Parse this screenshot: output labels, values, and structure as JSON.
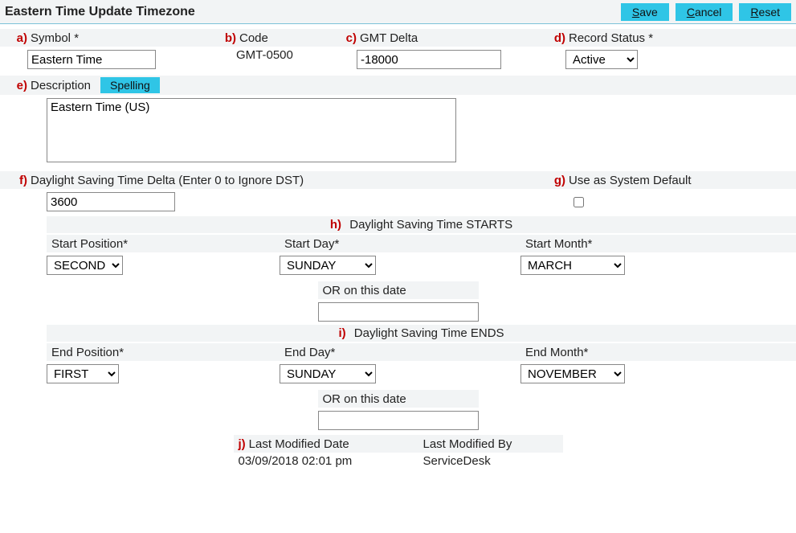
{
  "title": "Eastern Time Update Timezone",
  "buttons": {
    "save": "Save",
    "cancel": "Cancel",
    "reset": "Reset"
  },
  "markers": {
    "a": "a)",
    "b": "b)",
    "c": "c)",
    "d": "d)",
    "e": "e)",
    "f": "f)",
    "g": "g)",
    "h": "h)",
    "i": "i)",
    "j": "j)"
  },
  "fields": {
    "symbol": {
      "label": "Symbol",
      "value": "Eastern Time"
    },
    "code": {
      "label": "Code",
      "value": "GMT-0500"
    },
    "gmtdelta": {
      "label": "GMT Delta",
      "value": "-18000"
    },
    "recordstatus": {
      "label": "Record Status",
      "value": "Active"
    },
    "description": {
      "label": "Description",
      "spelling_btn": "Spelling",
      "value": "Eastern Time (US)"
    },
    "dstdelta": {
      "label": "Daylight Saving Time Delta (Enter 0 to Ignore DST)",
      "value": "3600"
    },
    "sysdefault": {
      "label": "Use as System Default",
      "checked": false
    },
    "dst_starts_header": "Daylight Saving Time STARTS",
    "start_position": {
      "label": "Start Position",
      "value": "SECOND"
    },
    "start_day": {
      "label": "Start Day",
      "value": "SUNDAY"
    },
    "start_month": {
      "label": "Start Month",
      "value": "MARCH"
    },
    "or_on_date_label": "OR on this date",
    "start_or_date": "",
    "dst_ends_header": "Daylight Saving Time ENDS",
    "end_position": {
      "label": "End Position",
      "value": "FIRST"
    },
    "end_day": {
      "label": "End Day",
      "value": "SUNDAY"
    },
    "end_month": {
      "label": "End Month",
      "value": "NOVEMBER"
    },
    "end_or_date": "",
    "last_mod_date": {
      "label": "Last Modified Date",
      "value": "03/09/2018 02:01 pm"
    },
    "last_mod_by": {
      "label": "Last Modified By",
      "value": "ServiceDesk"
    }
  }
}
